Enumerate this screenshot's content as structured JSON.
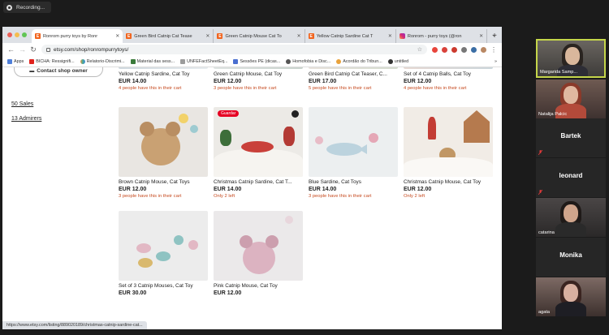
{
  "recording": {
    "label": "Recording..."
  },
  "browser": {
    "tabs": [
      {
        "title": "Ronrom purry toys by Ronr",
        "icon": "etsy",
        "active": true
      },
      {
        "title": "Green Bird Catnip Cat Tease",
        "icon": "etsy",
        "active": false
      },
      {
        "title": "Green Catnip Mouse Cat To",
        "icon": "etsy",
        "active": false
      },
      {
        "title": "Yellow Catnip Sardine Cat T",
        "icon": "etsy",
        "active": false
      },
      {
        "title": "Ronrom - purry toys (@ron",
        "icon": "instagram",
        "active": false
      }
    ],
    "new_tab": "+",
    "url": "etsy.com/shop/ronrompurrytoys/",
    "bookmarks": [
      "Apps",
      "BICHA: Ressignifi...",
      "Relatorio-Discrimi...",
      "Material das sess...",
      "UNFEFactSheetEq...",
      "Sessões PE (dicas...",
      "Homofobia e Disc...",
      "Acordão do Tribun...",
      "untitled"
    ],
    "bookmarks_more": "»",
    "status_url": "https://www.etsy.com/listing/889020189/christmas-catnip-sardine-cat..."
  },
  "shop": {
    "contact_button": "Contact shop owner",
    "sales_link": "50 Sales",
    "admirers_link": "13 Admirers",
    "pinterest_label": "Guardar"
  },
  "listings": [
    {
      "title": "Yellow Catnip Sardine, Cat Toy",
      "price": "EUR 14.00",
      "note": "4 people have this in their cart"
    },
    {
      "title": "Green Catnip Mouse, Cat Toy",
      "price": "EUR 12.00",
      "note": "3 people have this in their cart"
    },
    {
      "title": "Green Bird Catnip Cat Teaser, C...",
      "price": "EUR 17.00",
      "note": "5 people have this in their cart"
    },
    {
      "title": "Set of 4 Catnip Balls, Cat Toy",
      "price": "EUR 12.00",
      "note": "4 people have this in their cart"
    },
    {
      "title": "Brown Catnip Mouse, Cat Toys",
      "price": "EUR 12.00",
      "note": "3 people have this in their cart"
    },
    {
      "title": "Christmas Catnip Sardine, Cat T...",
      "price": "EUR 14.00",
      "note": "Only 2 left"
    },
    {
      "title": "Blue Sardine, Cat Toys",
      "price": "EUR 14.00",
      "note": "3 people have this in their cart"
    },
    {
      "title": "Christmas Catnip Mouse, Cat Toy",
      "price": "EUR 12.00",
      "note": "Only 2 left"
    },
    {
      "title": "Set of 3 Catnip Mouses, Cat Toy",
      "price": "EUR 30.00",
      "note": ""
    },
    {
      "title": "Pink Catnip Mouse, Cat Toy",
      "price": "EUR 12.00",
      "note": ""
    }
  ],
  "participants": [
    {
      "name": "Margarida Samp...",
      "video": true,
      "active": true
    },
    {
      "name": "Natalija Palcic",
      "video": true,
      "active": false
    },
    {
      "name": "Bartek",
      "video": false,
      "active": false
    },
    {
      "name": "leonard",
      "video": false,
      "active": false
    },
    {
      "name": "catarina",
      "video": true,
      "active": false
    },
    {
      "name": "Monika",
      "video": false,
      "active": false
    },
    {
      "name": "agata",
      "video": true,
      "active": false
    }
  ]
}
